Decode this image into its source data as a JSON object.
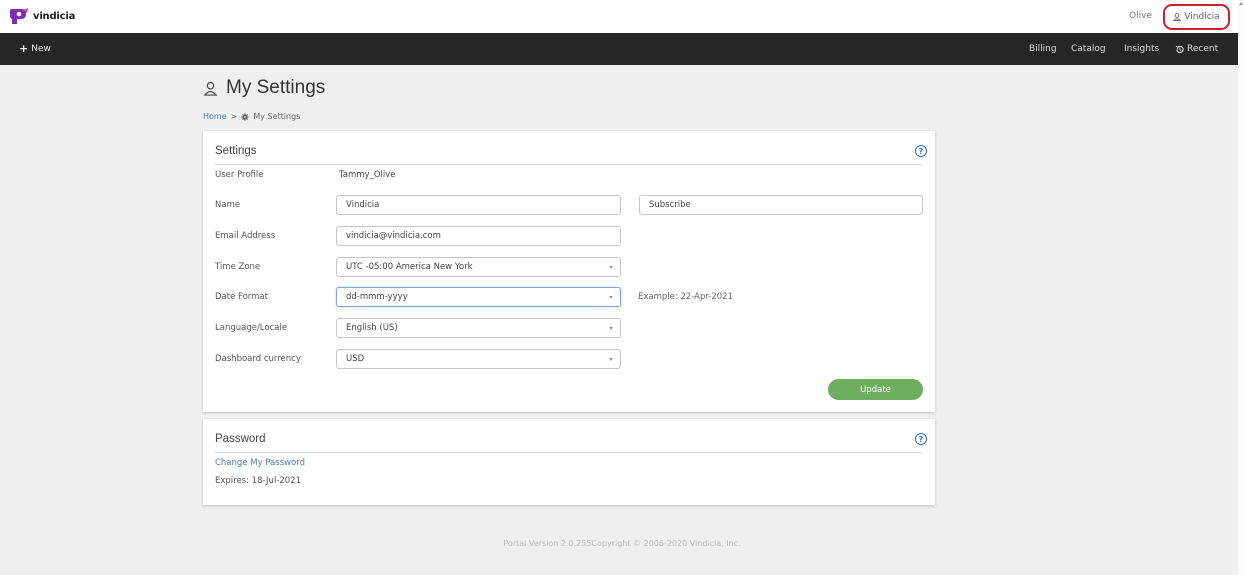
{
  "brand": {
    "name": "vindicia",
    "logo_color": "#7b2fb0"
  },
  "topbar": {
    "user_short": "Olive",
    "user_account": "Vindicia"
  },
  "nav": {
    "new_label": "New",
    "items": [
      "Billing",
      "Catalog",
      "Insights"
    ],
    "recent_label": "Recent"
  },
  "page": {
    "title": "My Settings",
    "breadcrumb": {
      "home": "Home",
      "separator": ">",
      "current": "My Settings"
    }
  },
  "settings": {
    "title": "Settings",
    "help_glyph": "?",
    "user_profile_label": "User Profile",
    "user_profile_value": "Tammy_Olive",
    "name_label": "Name",
    "name_value": "Vindicia",
    "subscribe_value": "Subscribe",
    "email_label": "Email Address",
    "email_value": "vindicia@vindicia.com",
    "timezone_label": "Time Zone",
    "timezone_value": "UTC -05:00 America New York",
    "date_format_label": "Date Format",
    "date_format_value": "dd-mmm-yyyy",
    "date_example": "Example: 22-Apr-2021",
    "locale_label": "Language/Locale",
    "locale_value": "English (US)",
    "currency_label": "Dashboard currency",
    "currency_value": "USD",
    "update_label": "Update"
  },
  "password": {
    "title": "Password",
    "help_glyph": "?",
    "change_link": "Change My Password",
    "expires": "Expires: 18-Jul-2021"
  },
  "footer": {
    "text": "Portal Version 2.0.255Copyright © 2006-2020 Vindicia, Inc."
  },
  "colors": {
    "highlight": "#d21d2c",
    "update_button": "#6fae5f",
    "link": "#4a7ab5",
    "help": "#2a6fc9"
  }
}
